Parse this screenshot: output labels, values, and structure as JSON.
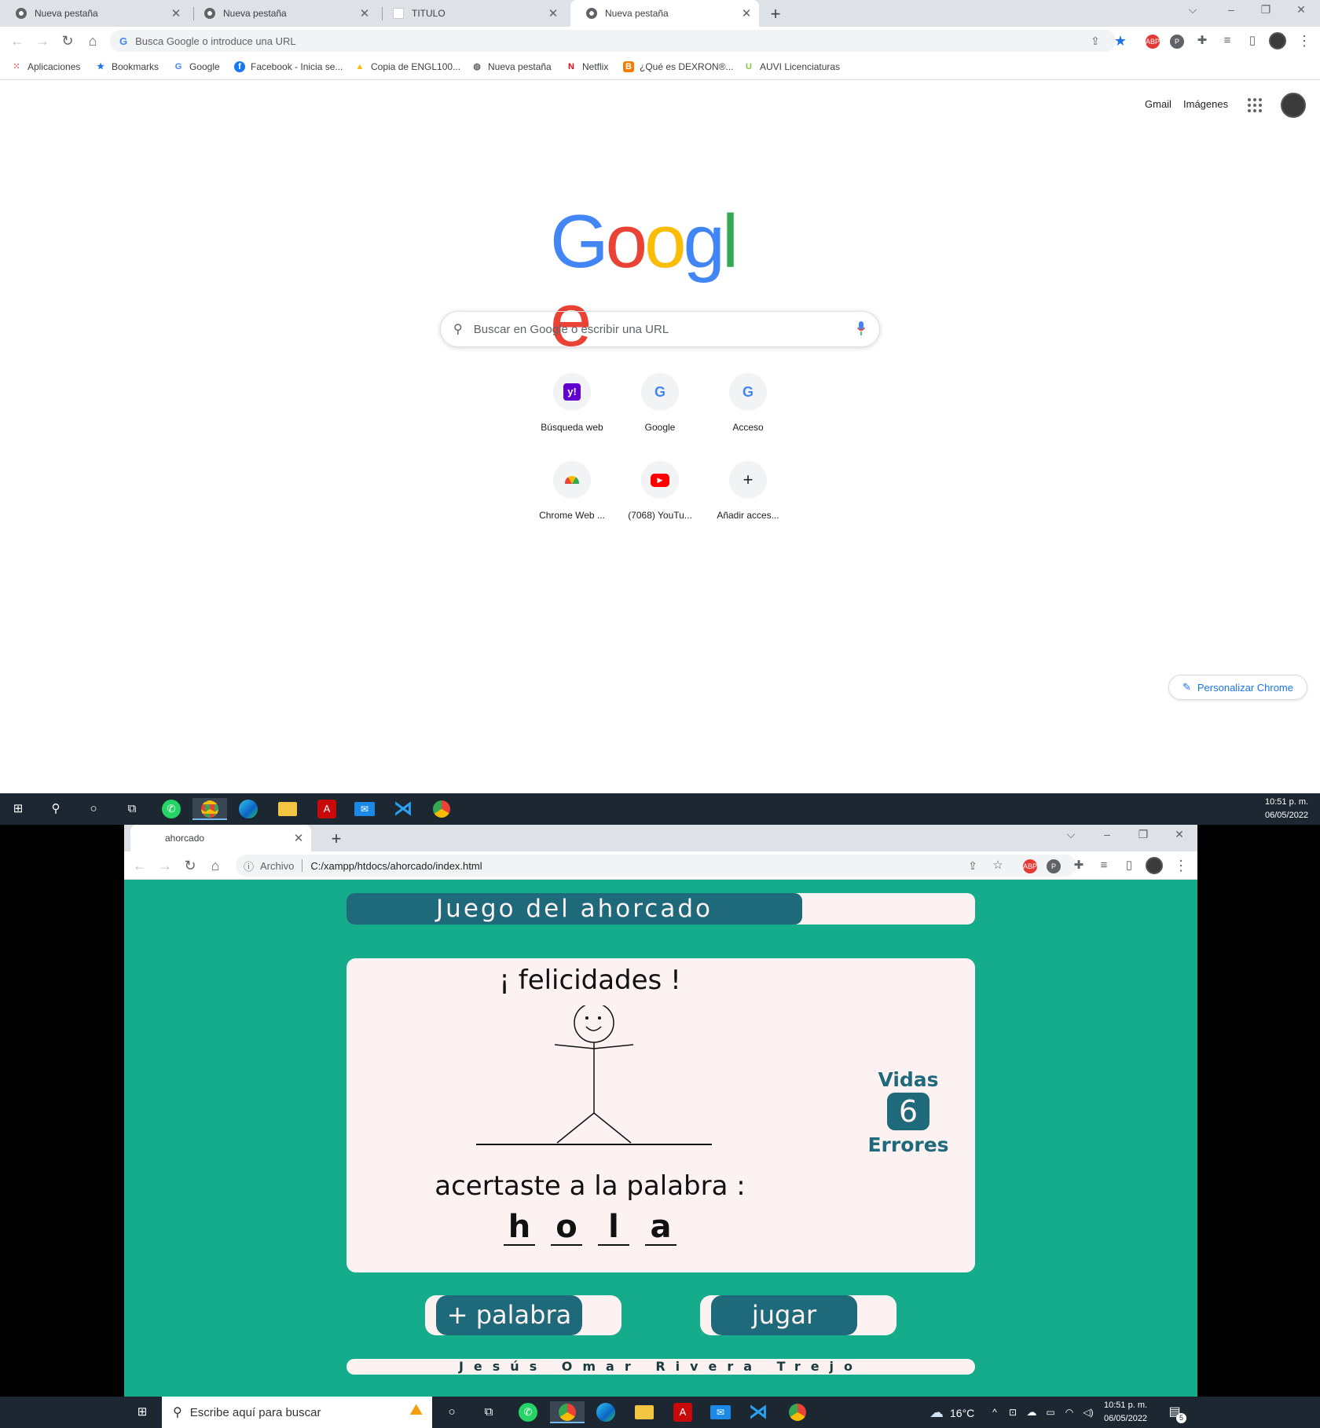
{
  "top_window": {
    "tabs": [
      {
        "title": "Nueva pestaña",
        "active": false
      },
      {
        "title": "Nueva pestaña",
        "active": false
      },
      {
        "title": "TITULO",
        "active": false
      },
      {
        "title": "Nueva pestaña",
        "active": true
      }
    ],
    "new_tab": "+",
    "omnibox_placeholder": "Busca Google o introduce una URL",
    "bookmarks": [
      {
        "label": "Aplicaciones",
        "icon": "apps-grid-icon"
      },
      {
        "label": "Bookmarks",
        "icon": "star-icon"
      },
      {
        "label": "Google",
        "icon": "google-icon"
      },
      {
        "label": "Facebook - Inicia se...",
        "icon": "facebook-icon"
      },
      {
        "label": "Copia de ENGL100...",
        "icon": "drive-icon"
      },
      {
        "label": "Nueva pestaña",
        "icon": "globe-icon"
      },
      {
        "label": "Netflix",
        "icon": "netflix-icon"
      },
      {
        "label": "¿Qué es DEXRON®...",
        "icon": "blogger-icon"
      },
      {
        "label": "AUVI Licenciaturas",
        "icon": "auvi-icon"
      }
    ],
    "ntp": {
      "gmail": "Gmail",
      "images": "Imágenes",
      "logo": [
        "G",
        "o",
        "o",
        "g",
        "l",
        "e"
      ],
      "logo_colors": [
        "#4285f4",
        "#ea4335",
        "#fbbc05",
        "#4285f4",
        "#34a853",
        "#ea4335"
      ],
      "search_placeholder": "Buscar en Google o escribir una URL",
      "shortcuts": [
        {
          "label": "Búsqueda web",
          "icon": "yahoo-icon"
        },
        {
          "label": "Google",
          "icon": "google-icon"
        },
        {
          "label": "Acceso",
          "icon": "google-icon"
        },
        {
          "label": "Chrome Web ...",
          "icon": "chrome-web-store-icon"
        },
        {
          "label": "(7068) YouTu...",
          "icon": "youtube-icon"
        },
        {
          "label": "Añadir acces...",
          "icon": "plus-icon"
        }
      ],
      "customize": "Personalizar Chrome"
    }
  },
  "taskbar_top": {
    "time": "10:51 p. m.",
    "date": "06/05/2022"
  },
  "bottom_window": {
    "tab_title": "ahorcado",
    "new_tab": "+",
    "url_label": "Archivo",
    "url": "C:/xampp/htdocs/ahorcado/index.html",
    "game": {
      "title": "Juego del ahorcado",
      "status": "¡ felicidades !",
      "message": "acertaste a la palabra :",
      "word": [
        "h",
        "o",
        "l",
        "a"
      ],
      "lives_label": "Vidas",
      "lives": "6",
      "errors_label": "Errores",
      "btn_add_word": "+ palabra",
      "btn_play": "jugar",
      "footer": "Jesús Omar Rivera Trejo"
    }
  },
  "taskbar_bottom": {
    "search_placeholder": "Escribe aquí para buscar",
    "weather": "16°C",
    "time": "10:51 p. m.",
    "date": "06/05/2022",
    "notifications": "5"
  },
  "colors": {
    "game_bg": "#14ac8b",
    "game_accent": "#1e6a7a",
    "game_card": "#fdf2f2",
    "taskbar": "#1c2732"
  }
}
